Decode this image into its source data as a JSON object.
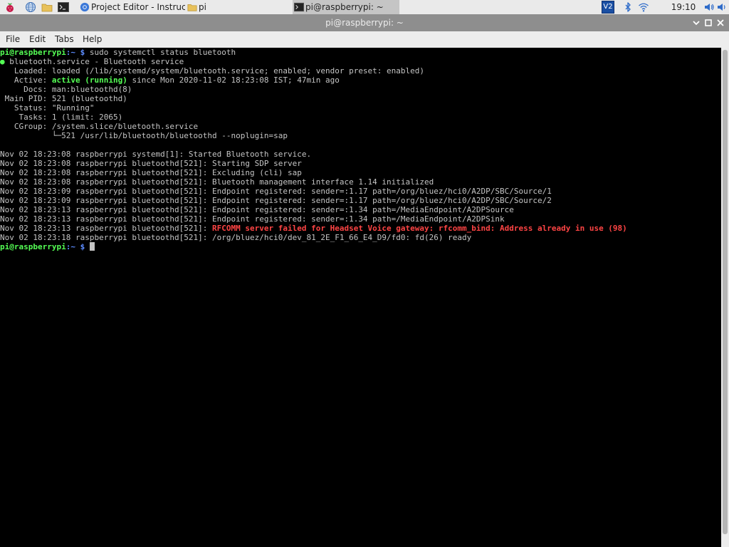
{
  "taskbar": {
    "tasks": [
      {
        "label": "Project Editor - Instructa..."
      },
      {
        "label": "pi"
      },
      {
        "label": "pi@raspberrypi: ~"
      }
    ],
    "vnc_label": "V2",
    "clock": "19:10"
  },
  "window": {
    "title": "pi@raspberrypi: ~"
  },
  "menu": {
    "items": [
      "File",
      "Edit",
      "Tabs",
      "Help"
    ]
  },
  "terminal": {
    "prompt_user": "pi@raspberrypi",
    "prompt_path": ":~",
    "prompt_dollar": " $ ",
    "command": "sudo systemctl status bluetooth",
    "unit_dot": "●",
    "unit_line": " bluetooth.service - Bluetooth service",
    "loaded_line": "   Loaded: loaded (/lib/systemd/system/bluetooth.service; enabled; vendor preset: enabled)",
    "active_label": "   Active: ",
    "active_status": "active (running)",
    "active_rest": " since Mon 2020-11-02 18:23:08 IST; 47min ago",
    "docs_line": "     Docs: man:bluetoothd(8)",
    "mainpid_line": " Main PID: 521 (bluetoothd)",
    "status_line": "   Status: \"Running\"",
    "tasks_line": "    Tasks: 1 (limit: 2065)",
    "cgroup_line": "   CGroup: /system.slice/bluetooth.service",
    "cgroup_child": "           └─521 /usr/lib/bluetooth/bluetoothd --noplugin=sap",
    "log_lines": [
      "Nov 02 18:23:08 raspberrypi systemd[1]: Started Bluetooth service.",
      "Nov 02 18:23:08 raspberrypi bluetoothd[521]: Starting SDP server",
      "Nov 02 18:23:08 raspberrypi bluetoothd[521]: Excluding (cli) sap",
      "Nov 02 18:23:08 raspberrypi bluetoothd[521]: Bluetooth management interface 1.14 initialized",
      "Nov 02 18:23:09 raspberrypi bluetoothd[521]: Endpoint registered: sender=:1.17 path=/org/bluez/hci0/A2DP/SBC/Source/1",
      "Nov 02 18:23:09 raspberrypi bluetoothd[521]: Endpoint registered: sender=:1.17 path=/org/bluez/hci0/A2DP/SBC/Source/2",
      "Nov 02 18:23:13 raspberrypi bluetoothd[521]: Endpoint registered: sender=:1.34 path=/MediaEndpoint/A2DPSource",
      "Nov 02 18:23:13 raspberrypi bluetoothd[521]: Endpoint registered: sender=:1.34 path=/MediaEndpoint/A2DPSink"
    ],
    "error_prefix": "Nov 02 18:23:13 raspberrypi bluetoothd[521]: ",
    "error_message": "RFCOMM server failed for Headset Voice gateway: rfcomm_bind: Address already in use (98)",
    "last_log_line": "Nov 02 18:23:18 raspberrypi bluetoothd[521]: /org/bluez/hci0/dev_81_2E_F1_66_E4_D9/fd0: fd(26) ready"
  },
  "colors": {
    "prompt_user": "#55ff55",
    "prompt_path": "#5c8cff",
    "active_status": "#55ff55",
    "error_text": "#ff4444",
    "terminal_bg": "#000000",
    "terminal_fg": "#c4c4c4"
  }
}
